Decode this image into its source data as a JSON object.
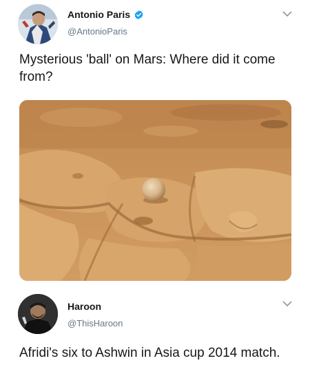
{
  "tweets": [
    {
      "author_name": "Antonio Paris",
      "verified": true,
      "handle": "@AntonioParis",
      "text": "Mysterious 'ball' on Mars: Where did it come from?",
      "media": {
        "kind": "photo",
        "subject": "mars-rock-sphere"
      },
      "menu_icon": "chevron-down-icon"
    },
    {
      "author_name": "Haroon",
      "verified": false,
      "handle": "@ThisHaroon",
      "text": "Afridi's six to Ashwin in Asia cup 2014 match.",
      "menu_icon": "chevron-down-icon"
    }
  ],
  "colors": {
    "text_primary": "#14171a",
    "text_secondary": "#657786",
    "verified_blue": "#1da1f2",
    "mars_sand": "#c8935a"
  }
}
